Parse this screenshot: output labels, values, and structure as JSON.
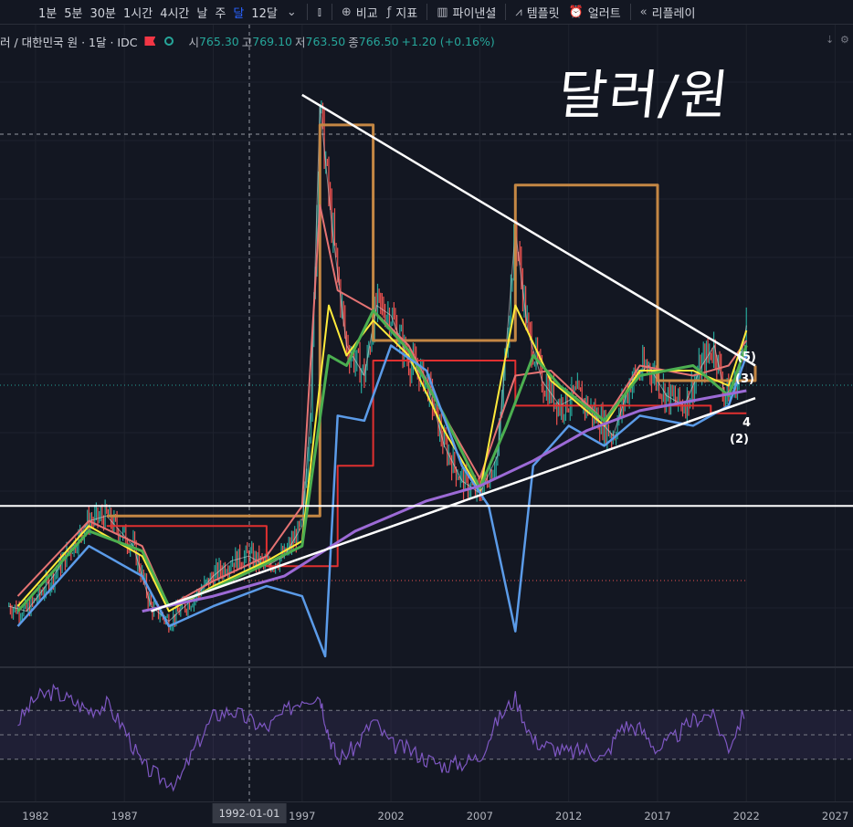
{
  "toolbar": {
    "timeframes": [
      "1분",
      "5분",
      "30분",
      "1시간",
      "4시간",
      "날",
      "주",
      "달",
      "12달"
    ],
    "active_timeframe": "달",
    "compare_label": "비교",
    "indicators_label": "지표",
    "financials_label": "파이낸셜",
    "templates_label": "템플릿",
    "alerts_label": "얼러트",
    "replay_label": "리플레이"
  },
  "legend": {
    "symbol": "러 / 대한민국 원 · 1달 · IDC",
    "open_key": "시",
    "open": "765.30",
    "high_key": "고",
    "high": "769.10",
    "low_key": "저",
    "low": "763.50",
    "close_key": "종",
    "close": "766.50",
    "change": "+1.20 (+0.16%)"
  },
  "annotation": {
    "title": "달러/원"
  },
  "wave_labels": [
    "(5)",
    "(3)",
    "4",
    "(2)"
  ],
  "colors": {
    "background": "#131722",
    "grid": "#1e222d",
    "white_lines": "#ffffff",
    "ma_orange": "#c48744",
    "ma_red": "#e03030",
    "ma_salmon": "#e57373",
    "ma_yellow": "#ffeb3b",
    "ma_green": "#4caf50",
    "ma_blue": "#5b9be8",
    "ma_purple": "#9c6ad6",
    "ma_white": "#e0e0e0",
    "rsi": "#7e57c2",
    "up": "#26a69a",
    "down": "#ef5350"
  },
  "icons": [
    "chevron-down-icon",
    "candlestick-icon",
    "plus-circle-icon",
    "fx-icon",
    "bar-chart-icon",
    "template-icon",
    "alarm-clock-icon",
    "rewind-icon"
  ],
  "chart_data": {
    "type": "line",
    "x_range": [
      1980,
      2028
    ],
    "x_tick_labels": [
      "1982",
      "1987",
      "1992-01-01",
      "1997",
      "2002",
      "2007",
      "2012",
      "2017",
      "2022",
      "2027"
    ],
    "crosshair_date": "1992-01-01",
    "series": [
      {
        "points": [
          [
            1980.5,
            700
          ],
          [
            1981.5,
            690
          ],
          [
            1983,
            760
          ],
          [
            1985,
            870
          ],
          [
            1986,
            880
          ],
          [
            1987.5,
            820
          ],
          [
            1988.5,
            700
          ],
          [
            1989.5,
            670
          ],
          [
            1991,
            720
          ],
          [
            1992,
            760
          ],
          [
            1993,
            790
          ],
          [
            1994,
            800
          ],
          [
            1995,
            780
          ],
          [
            1996,
            800
          ],
          [
            1997,
            860
          ],
          [
            1997.5,
            1100
          ],
          [
            1998,
            1700
          ],
          [
            1998.7,
            1450
          ],
          [
            1999.5,
            1220
          ],
          [
            2000.5,
            1160
          ],
          [
            2001.2,
            1300
          ],
          [
            2002,
            1280
          ],
          [
            2003,
            1190
          ],
          [
            2004,
            1150
          ],
          [
            2005,
            1020
          ],
          [
            2006,
            950
          ],
          [
            2007,
            925
          ],
          [
            2008,
            1000
          ],
          [
            2009,
            1450
          ],
          [
            2009.7,
            1250
          ],
          [
            2010.5,
            1150
          ],
          [
            2011.5,
            1100
          ],
          [
            2012.5,
            1120
          ],
          [
            2013.5,
            1080
          ],
          [
            2014.5,
            1040
          ],
          [
            2015.5,
            1150
          ],
          [
            2016.5,
            1180
          ],
          [
            2017.5,
            1120
          ],
          [
            2018.5,
            1100
          ],
          [
            2019.5,
            1180
          ],
          [
            2020.2,
            1220
          ],
          [
            2020.8,
            1120
          ],
          [
            2021.5,
            1150
          ],
          [
            2022,
            1260
          ]
        ]
      },
      {
        "points": [
          [
            1986,
            880
          ],
          [
            1990,
            880
          ],
          [
            1990,
            880
          ],
          [
            1998,
            880
          ],
          [
            1998,
            1660
          ],
          [
            2001,
            1660
          ],
          [
            2001,
            1230
          ],
          [
            2009,
            1230
          ],
          [
            2009,
            1540
          ],
          [
            2017,
            1540
          ],
          [
            2017,
            1150
          ],
          [
            2022.5,
            1150
          ],
          [
            2022.5,
            1180
          ]
        ]
      },
      {
        "points": [
          [
            1986,
            860
          ],
          [
            1995,
            860
          ],
          [
            1995,
            780
          ],
          [
            1999,
            780
          ],
          [
            1999,
            980
          ],
          [
            2001,
            980
          ],
          [
            2001,
            1190
          ],
          [
            2009,
            1190
          ],
          [
            2009,
            1100
          ],
          [
            2020,
            1100
          ],
          [
            2020,
            1085
          ],
          [
            2022,
            1085
          ]
        ]
      },
      {
        "points": [
          [
            1981,
            720
          ],
          [
            1985,
            870
          ],
          [
            1988,
            820
          ],
          [
            1989.5,
            700
          ],
          [
            1992,
            750
          ],
          [
            1995,
            800
          ],
          [
            1997,
            900
          ],
          [
            1998,
            1500
          ],
          [
            1999,
            1330
          ],
          [
            2001,
            1290
          ],
          [
            2003,
            1220
          ],
          [
            2005,
            1080
          ],
          [
            2007,
            955
          ],
          [
            2009,
            1160
          ],
          [
            2011,
            1170
          ],
          [
            2014,
            1070
          ],
          [
            2016,
            1180
          ],
          [
            2019,
            1160
          ],
          [
            2021,
            1180
          ],
          [
            2022,
            1230
          ]
        ]
      },
      {
        "points": [
          [
            1981,
            700
          ],
          [
            1985,
            860
          ],
          [
            1988,
            800
          ],
          [
            1989.5,
            690
          ],
          [
            1992,
            740
          ],
          [
            1995,
            790
          ],
          [
            1997,
            830
          ],
          [
            1998.5,
            1300
          ],
          [
            1999.5,
            1200
          ],
          [
            2001,
            1270
          ],
          [
            2003,
            1200
          ],
          [
            2005,
            1050
          ],
          [
            2007,
            930
          ],
          [
            2009,
            1300
          ],
          [
            2011,
            1150
          ],
          [
            2014,
            1060
          ],
          [
            2016,
            1170
          ],
          [
            2019,
            1170
          ],
          [
            2021,
            1140
          ],
          [
            2022,
            1250
          ]
        ]
      },
      {
        "points": [
          [
            1981,
            690
          ],
          [
            1985,
            850
          ],
          [
            1988,
            810
          ],
          [
            1989.5,
            700
          ],
          [
            1992,
            735
          ],
          [
            1995,
            785
          ],
          [
            1997,
            820
          ],
          [
            1998.5,
            1200
          ],
          [
            1999.5,
            1180
          ],
          [
            2001,
            1290
          ],
          [
            2003,
            1210
          ],
          [
            2005,
            1080
          ],
          [
            2007,
            935
          ],
          [
            2008.5,
            1060
          ],
          [
            2010,
            1200
          ],
          [
            2011.5,
            1140
          ],
          [
            2014,
            1070
          ],
          [
            2016,
            1160
          ],
          [
            2019,
            1180
          ],
          [
            2021,
            1120
          ],
          [
            2022,
            1220
          ]
        ]
      },
      {
        "points": [
          [
            1981,
            660
          ],
          [
            1985,
            820
          ],
          [
            1988,
            760
          ],
          [
            1989.5,
            660
          ],
          [
            1992,
            700
          ],
          [
            1995,
            740
          ],
          [
            1997,
            720
          ],
          [
            1998.3,
            600
          ],
          [
            1999,
            1080
          ],
          [
            2000.5,
            1070
          ],
          [
            2002,
            1220
          ],
          [
            2004,
            1170
          ],
          [
            2006,
            980
          ],
          [
            2007.5,
            900
          ],
          [
            2009,
            650
          ],
          [
            2010,
            980
          ],
          [
            2012,
            1060
          ],
          [
            2014,
            1020
          ],
          [
            2016,
            1080
          ],
          [
            2019,
            1060
          ],
          [
            2021,
            1100
          ],
          [
            2022,
            1200
          ]
        ]
      },
      {
        "points": [
          [
            1988,
            690
          ],
          [
            1992,
            720
          ],
          [
            1996,
            760
          ],
          [
            2000,
            850
          ],
          [
            2004,
            910
          ],
          [
            2007,
            940
          ],
          [
            2010,
            990
          ],
          [
            2013,
            1050
          ],
          [
            2016,
            1090
          ],
          [
            2019,
            1110
          ],
          [
            2022,
            1130
          ]
        ]
      }
    ],
    "trendlines": [
      {
        "from": [
          1988.5,
          690
        ],
        "to": [
          2022.5,
          1115
        ]
      },
      {
        "from": [
          1997,
          1720
        ],
        "to": [
          2022.5,
          1180
        ]
      },
      {
        "level": 900
      }
    ],
    "rsi": {
      "range": [
        0,
        100
      ],
      "bands": [
        30,
        50,
        70
      ],
      "points": [
        [
          1981,
          60
        ],
        [
          1982,
          80
        ],
        [
          1983,
          85
        ],
        [
          1984,
          78
        ],
        [
          1985,
          70
        ],
        [
          1986,
          75
        ],
        [
          1987,
          55
        ],
        [
          1988,
          25
        ],
        [
          1989,
          15
        ],
        [
          1990,
          10
        ],
        [
          1991,
          40
        ],
        [
          1992,
          65
        ],
        [
          1993,
          70
        ],
        [
          1994,
          62
        ],
        [
          1995,
          55
        ],
        [
          1996,
          68
        ],
        [
          1997,
          80
        ],
        [
          1998,
          82
        ],
        [
          1998.5,
          50
        ],
        [
          1999,
          30
        ],
        [
          2000,
          40
        ],
        [
          2001,
          62
        ],
        [
          2002,
          42
        ],
        [
          2003,
          38
        ],
        [
          2004,
          30
        ],
        [
          2005,
          25
        ],
        [
          2006,
          27
        ],
        [
          2007,
          32
        ],
        [
          2008,
          62
        ],
        [
          2009,
          80
        ],
        [
          2010,
          45
        ],
        [
          2011,
          40
        ],
        [
          2012,
          35
        ],
        [
          2013,
          38
        ],
        [
          2014,
          30
        ],
        [
          2015,
          58
        ],
        [
          2016,
          55
        ],
        [
          2017,
          38
        ],
        [
          2018,
          48
        ],
        [
          2019,
          62
        ],
        [
          2020,
          68
        ],
        [
          2021,
          40
        ],
        [
          2022,
          72
        ]
      ]
    }
  }
}
